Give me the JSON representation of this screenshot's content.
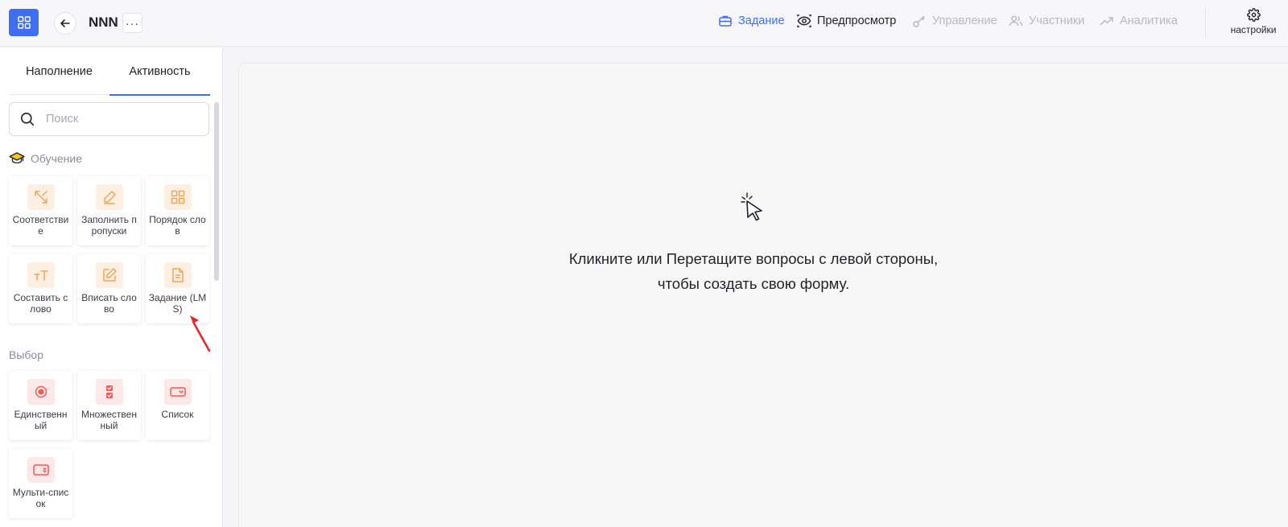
{
  "header": {
    "app_title": "NNN",
    "more_label": "···",
    "nav": [
      {
        "label": "Задание",
        "icon": "briefcase-icon",
        "state": "active"
      },
      {
        "label": "Предпросмотр",
        "icon": "eye-icon",
        "state": "normal"
      },
      {
        "label": "Управление",
        "icon": "key-icon",
        "state": "disabled"
      },
      {
        "label": "Участники",
        "icon": "users-icon",
        "state": "disabled"
      },
      {
        "label": "Аналитика",
        "icon": "trend-up-icon",
        "state": "disabled"
      }
    ],
    "settings_label": "настройки"
  },
  "sidebar": {
    "tabs": [
      {
        "label": "Наполнение",
        "active": false
      },
      {
        "label": "Активность",
        "active": true
      }
    ],
    "search": {
      "placeholder": "Поиск",
      "value": ""
    },
    "sections": [
      {
        "title": "Обучение",
        "icon": "graduation-cap-icon",
        "items": [
          {
            "label": "Соответствие",
            "icon": "arrows-diagonal-icon"
          },
          {
            "label": "Заполнить пропуски",
            "icon": "pencil-icon"
          },
          {
            "label": "Порядок слов",
            "icon": "grid-icon"
          },
          {
            "label": "Составить слово",
            "icon": "text-size-icon"
          },
          {
            "label": "Вписать слово",
            "icon": "edit-square-icon"
          },
          {
            "label": "Задание (LMS)",
            "icon": "document-icon"
          }
        ]
      },
      {
        "title": "Выбор",
        "items": [
          {
            "label": "Единственный",
            "icon": "radio-icon"
          },
          {
            "label": "Множественный",
            "icon": "checkbox-list-icon"
          },
          {
            "label": "Список",
            "icon": "dropdown-icon"
          },
          {
            "label": "Мульти-список",
            "icon": "multi-dropdown-icon"
          }
        ]
      }
    ]
  },
  "canvas": {
    "hint_line1": "Кликните или Перетащите вопросы с левой стороны,",
    "hint_line2": "чтобы создать свою форму."
  },
  "colors": {
    "accent": "#3f6ff0",
    "orange_icon": "#f0a45a",
    "red_icon": "#ef5a5a",
    "annotation_arrow": "#e8262a"
  }
}
